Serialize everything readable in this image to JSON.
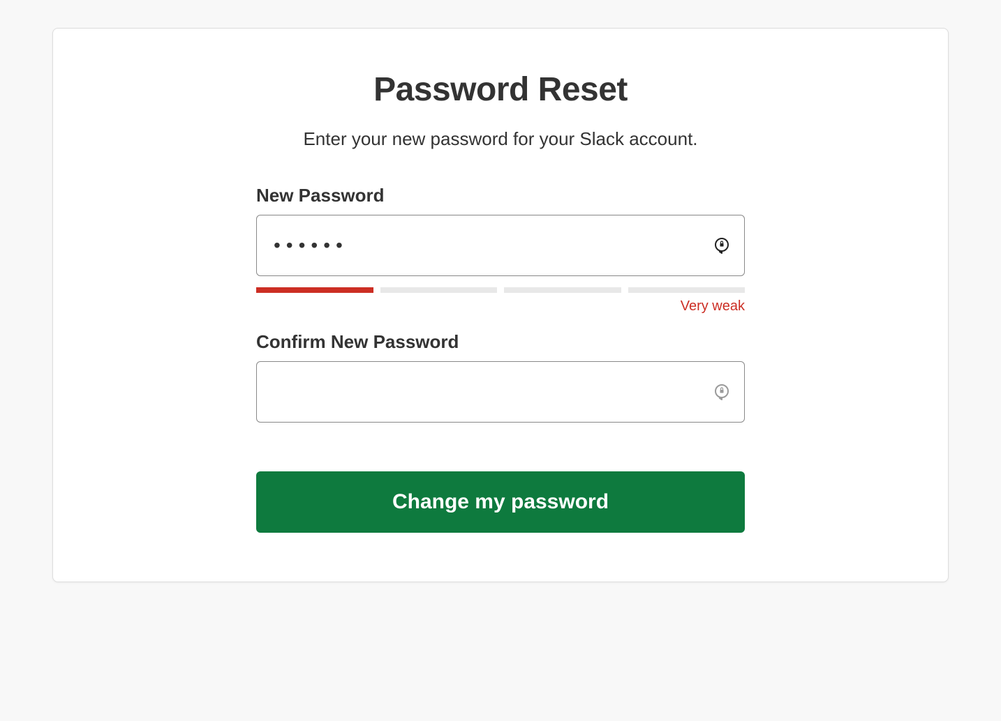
{
  "page": {
    "title": "Password Reset",
    "subtitle": "Enter your new password for your  Slack account."
  },
  "fields": {
    "new_password": {
      "label": "New Password",
      "value": "••••••"
    },
    "confirm_password": {
      "label": "Confirm New Password",
      "value": ""
    }
  },
  "strength": {
    "label": "Very weak",
    "level": 1,
    "total_bars": 4,
    "color": "#cc2e24"
  },
  "actions": {
    "submit_label": "Change my password"
  }
}
